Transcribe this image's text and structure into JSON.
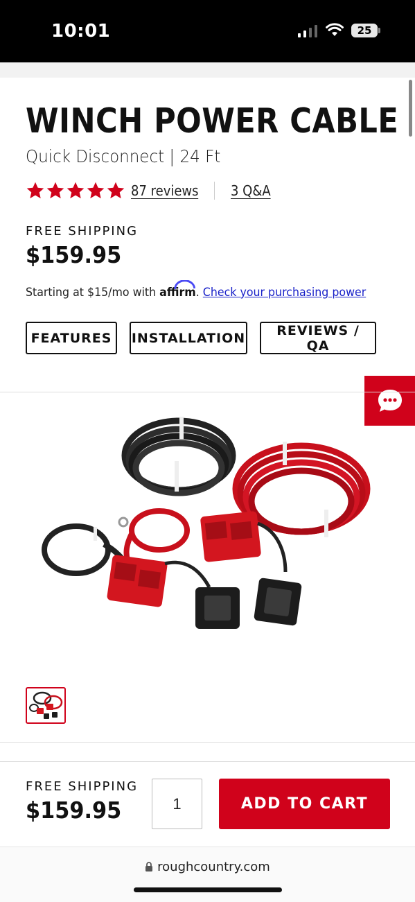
{
  "status_bar": {
    "time": "10:01",
    "battery": "25"
  },
  "product": {
    "title": "WINCH POWER CABLE",
    "subtitle": "Quick Disconnect | 24 Ft",
    "rating_stars": 5,
    "reviews_label": "87 reviews",
    "qa_label": "3 Q&A",
    "free_shipping": "FREE SHIPPING",
    "price": "$159.95"
  },
  "financing": {
    "prefix": "Starting at $15/mo with ",
    "brand": "affirm",
    "separator": ". ",
    "link": "Check your purchasing power"
  },
  "tabs": [
    {
      "label": "FEATURES"
    },
    {
      "label": "INSTALLATION"
    },
    {
      "label": "REVIEWS / QA"
    }
  ],
  "sticky_bar": {
    "free_shipping": "FREE SHIPPING",
    "price": "$159.95",
    "quantity": "1",
    "add_to_cart": "ADD TO CART"
  },
  "browser": {
    "url": "roughcountry.com"
  },
  "colors": {
    "brand_red": "#d0021b",
    "link_blue": "#1a22c9",
    "text": "#111111"
  },
  "icons": [
    "signal-icon",
    "wifi-icon",
    "battery-icon",
    "star-icon",
    "chat-icon",
    "lock-icon"
  ]
}
